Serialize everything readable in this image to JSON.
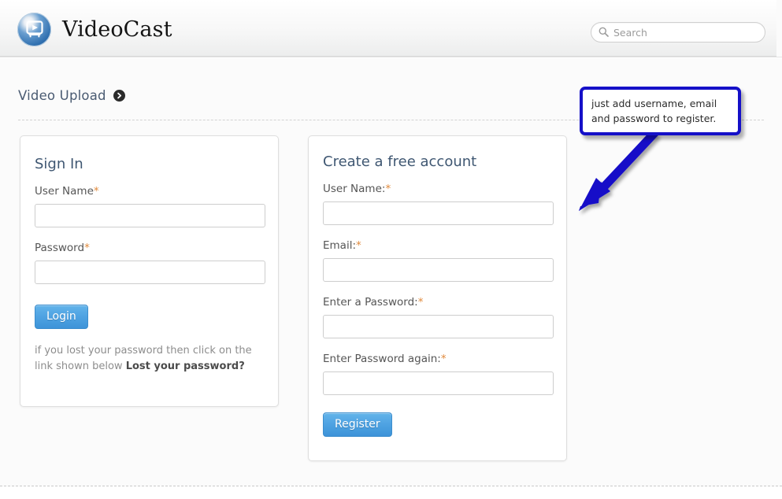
{
  "header": {
    "brand_title": "VideoCast",
    "logo_icon": "videocast-play-screen-icon",
    "search": {
      "placeholder": "Search",
      "value": "",
      "icon": "search-icon"
    }
  },
  "breadcrumb": {
    "label": "Video Upload",
    "arrow_icon": "chevron-right-circle-icon"
  },
  "signin_panel": {
    "title": "Sign In",
    "fields": [
      {
        "label": "User Name",
        "required_mark": "*",
        "value": "",
        "type": "text"
      },
      {
        "label": "Password",
        "required_mark": "*",
        "value": "",
        "type": "password"
      }
    ],
    "submit_label": "Login",
    "hint_text": "if you lost your password then click on the link shown below ",
    "hint_link_label": "Lost your password?"
  },
  "register_panel": {
    "title": "Create a free account",
    "fields": [
      {
        "label": "User Name:",
        "required_mark": "*",
        "value": "",
        "type": "text"
      },
      {
        "label": "Email:",
        "required_mark": "*",
        "value": "",
        "type": "text"
      },
      {
        "label": "Enter a Password:",
        "required_mark": "*",
        "value": "",
        "type": "password"
      },
      {
        "label": "Enter Password again:",
        "required_mark": "*",
        "value": "",
        "type": "password"
      }
    ],
    "submit_label": "Register"
  },
  "annotation": {
    "callout_text": "just add username, email and password to register.",
    "arrow_icon": "arrow-down-left-icon",
    "color": "#1510c8"
  },
  "colors": {
    "accent_blue": "#4ea2e2",
    "heading_blue": "#3f5772",
    "required_orange": "#e08a3c",
    "annotation_blue": "#1510c8",
    "page_background": "#fbfbfb"
  }
}
